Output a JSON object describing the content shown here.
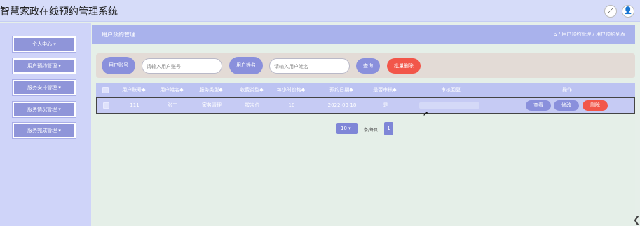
{
  "app": {
    "title": "智慧家政在线预约管理系统"
  },
  "topbar": {
    "fullscreen_icon": "⤢",
    "user_icon": "👤"
  },
  "sidebar": {
    "items": [
      {
        "label": "个人中心 ▾"
      },
      {
        "label": "用户预约管理 ▾"
      },
      {
        "label": "服务安排管理 ▾"
      },
      {
        "label": "服务情况管理 ▾"
      },
      {
        "label": "服务完成管理 ▾"
      }
    ]
  },
  "header": {
    "title": "用户预约管理",
    "breadcrumb": "⌂ / 用户预约管理 / 用户预约列表"
  },
  "search": {
    "account_label": "用户账号",
    "account_placeholder": "请输入用户账号",
    "name_label": "用户姓名",
    "name_placeholder": "请输入用户姓名",
    "query_button": "查询",
    "batch_delete_button": "批量删除"
  },
  "table": {
    "headers": [
      "用户账号◆",
      "用户姓名◆",
      "服务类型◆",
      "收费类型◆",
      "每小时价格◆",
      "预约日期◆",
      "是否审核◆",
      "审核回复",
      "操作"
    ],
    "rows": [
      {
        "account": "111",
        "name": "张三",
        "service_type": "家务清理",
        "fee_type": "按次价",
        "hourly_price": "10",
        "date": "2022-03-18",
        "reviewed": "是",
        "reply": "",
        "actions": {
          "view": "查看",
          "edit": "修改",
          "delete": "删除"
        }
      }
    ]
  },
  "pagination": {
    "page_size": "10 ▾",
    "per_page_label": "条/每页",
    "current_page": "1"
  },
  "colors": {
    "accent": "#8a90dc",
    "danger": "#f2564a",
    "header_bg": "#a9b2ec"
  }
}
